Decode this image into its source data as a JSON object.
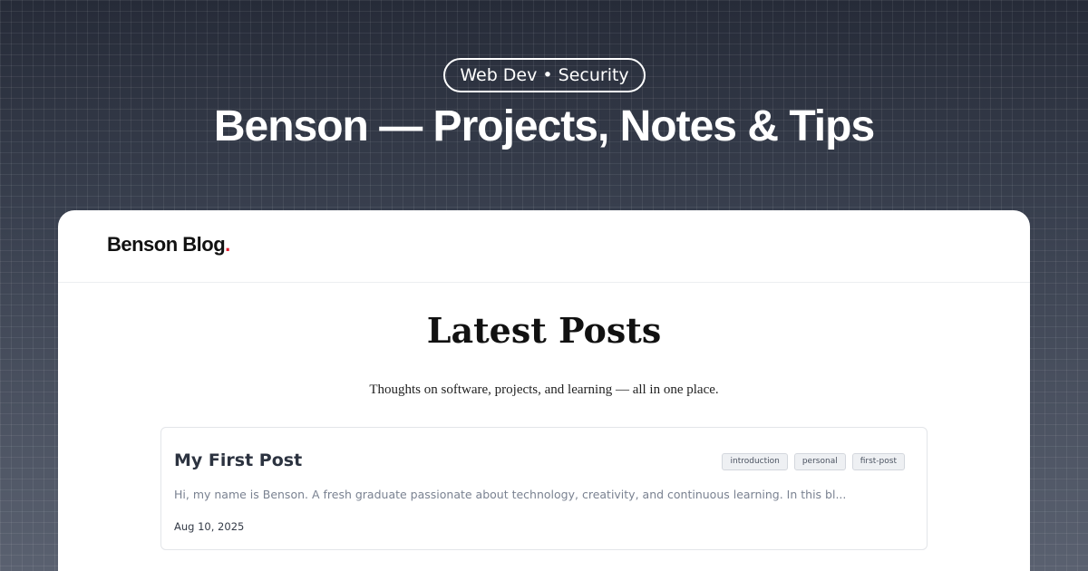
{
  "hero": {
    "badge": "Web Dev • Security",
    "title": "Benson — Projects, Notes & Tips"
  },
  "site": {
    "logo_text": "Benson Blog",
    "logo_dot": ".",
    "accent_color": "#e11d2e"
  },
  "main": {
    "heading": "Latest Posts",
    "subtitle": "Thoughts on software, projects, and learning — all in one place."
  },
  "posts": [
    {
      "title": "My First Post",
      "tags": [
        "introduction",
        "personal",
        "first-post"
      ],
      "excerpt": "Hi, my name is Benson. A fresh graduate passionate about technology, creativity, and continuous learning. In this bl...",
      "date": "Aug 10, 2025"
    }
  ]
}
